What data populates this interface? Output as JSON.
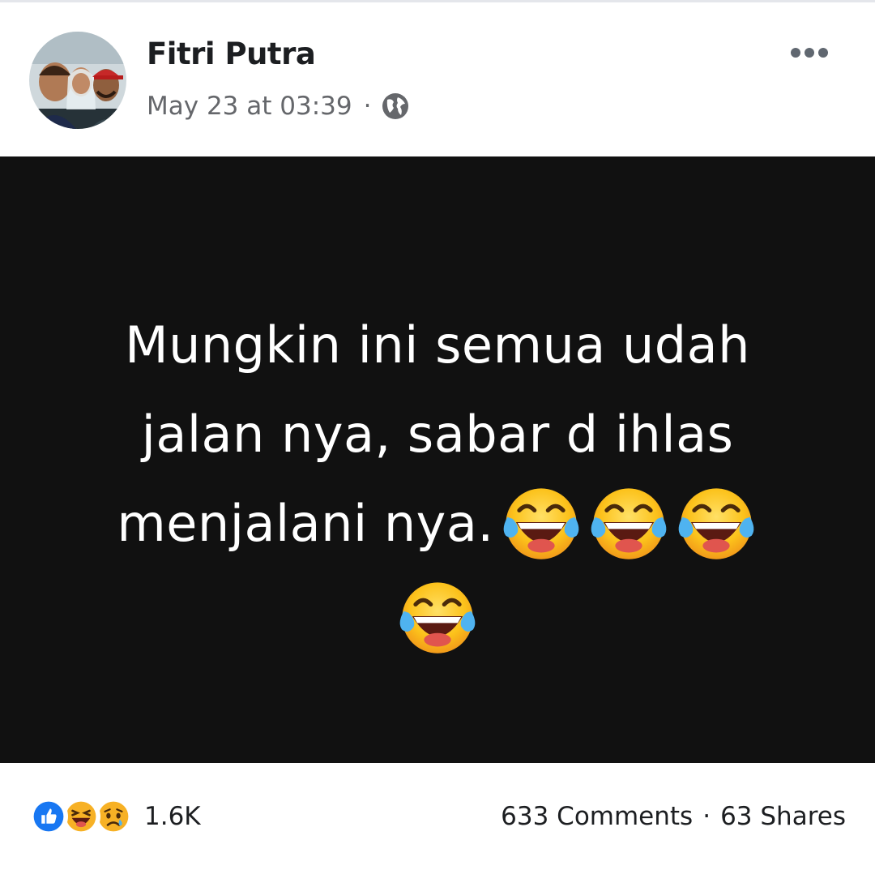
{
  "post": {
    "author_name": "Fitri Putra",
    "timestamp": "May 23 at 03:39",
    "separator": "·",
    "privacy_icon": "globe-icon",
    "more_icon": "more-horizontal-icon",
    "avatar_icon": "profile-photo",
    "background_color": "#111111",
    "text_lines": [
      "Mungkin ini semua udah",
      "jalan nya, sabar d ihlas",
      "menjalani nya."
    ],
    "emoji_icon": "face-with-tears-of-joy-icon"
  },
  "footer": {
    "reaction_icons": [
      "like-icon",
      "laughing-icon",
      "sad-icon"
    ],
    "reaction_count": "1.6K",
    "comments": "633 Comments",
    "separator": "·",
    "shares": "63 Shares"
  },
  "colors": {
    "like_blue": "#1877f2",
    "emoji_yellow": "#f7b125",
    "text_secondary": "#65676b"
  }
}
